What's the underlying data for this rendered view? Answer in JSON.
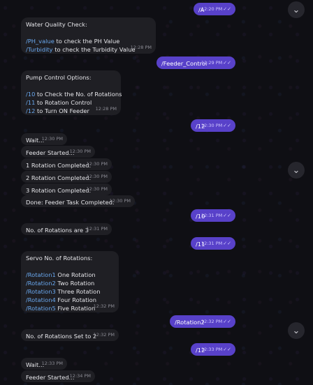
{
  "chat": {
    "m1": {
      "text": "/A",
      "time": "12:20 PM",
      "ticks": "✓✓"
    },
    "m2": {
      "title": "Water Quality Check:",
      "l1cmd": "/PH_value",
      "l1rest": " to check the PH Value",
      "l2cmd": "/Turbidity",
      "l2rest": " to check the Turbidity Value",
      "time": "12:28 PM"
    },
    "m3": {
      "text": "/Feeder_Control",
      "time": "12:29 PM",
      "ticks": "✓✓"
    },
    "m4": {
      "title": "Pump Control Options:",
      "l1cmd": "/10",
      "l1rest": " to Check the No. of Rotations",
      "l2cmd": "/11",
      "l2rest": " to Rotation Control",
      "l3cmd": "/12",
      "l3rest": " to Turn ON Feeder",
      "time": "12:28 PM"
    },
    "m5": {
      "text": "/12",
      "time": "12:30 PM",
      "ticks": "✓✓"
    },
    "m6": {
      "text": "Wait...",
      "time": "12:30 PM"
    },
    "m7": {
      "text": "Feeder Started...",
      "time": "12:30 PM"
    },
    "m8": {
      "text": "1 Rotation Completed.",
      "time": "12:30 PM"
    },
    "m9": {
      "text": "2 Rotation Completed.",
      "time": "12:30 PM"
    },
    "m10": {
      "text": "3 Rotation Completed.",
      "time": "12:30 PM"
    },
    "m11": {
      "text": "Done: Feeder Task Completed.",
      "time": "12:30 PM"
    },
    "m12": {
      "text": "/10",
      "time": "12:31 PM",
      "ticks": "✓✓"
    },
    "m13": {
      "text": "No. of Rotations are 3",
      "time": "12:31 PM"
    },
    "m14": {
      "text": "/11",
      "time": "12:31 PM",
      "ticks": "✓✓"
    },
    "m15": {
      "title": "Servo No. of Rotations:",
      "r1cmd": "/Rotation1",
      "r1rest": " One Rotation",
      "r2cmd": "/Rotation2",
      "r2rest": " Two Rotation",
      "r3cmd": "/Rotation3",
      "r3rest": " Three Rotation",
      "r4cmd": "/Rotation4",
      "r4rest": " Four Rotation",
      "r5cmd": "/Rotation5",
      "r5rest": " Five Rotation",
      "time": "12:32 PM"
    },
    "m16": {
      "text": "/Rotation2",
      "time": "12:32 PM",
      "ticks": "✓✓"
    },
    "m17": {
      "text": "No. of Rotations Set to 2",
      "time": "12:32 PM"
    },
    "m18": {
      "text": "/12",
      "time": "12:33 PM",
      "ticks": "✓✓"
    },
    "m19": {
      "text": "Wait...",
      "time": "12:33 PM"
    },
    "m20": {
      "text": "Feeder Started...",
      "time": "12:34 PM"
    }
  },
  "scroll_icon": "chevron-down-icon"
}
